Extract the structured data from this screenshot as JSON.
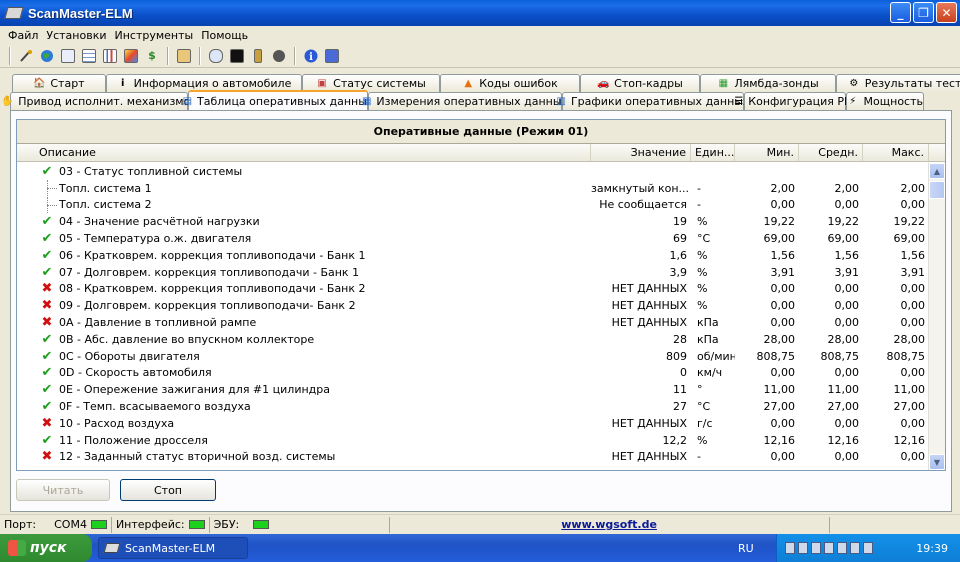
{
  "window": {
    "title": "ScanMaster-ELM"
  },
  "menu": [
    "Файл",
    "Установки",
    "Инструменты",
    "Помощь"
  ],
  "toolbar_icons": [
    "connect-icon",
    "globe-icon",
    "document-icon",
    "table-icon",
    "chart-icon",
    "graph-icon",
    "dollar-icon",
    "clipboard-icon",
    "comment-icon",
    "terminal-icon",
    "plug-icon",
    "record-icon",
    "info-icon",
    "book-icon"
  ],
  "tabs_row1": [
    {
      "label": "Старт",
      "icon": "start-icon"
    },
    {
      "label": "Информация о автомобиле",
      "icon": "info-icon"
    },
    {
      "label": "Статус системы",
      "icon": "status-icon"
    },
    {
      "label": "Коды ошибок",
      "icon": "warning-icon"
    },
    {
      "label": "Стоп-кадры",
      "icon": "freeze-icon"
    },
    {
      "label": "Лямбда-зонды",
      "icon": "lambda-icon"
    },
    {
      "label": "Результаты теста",
      "icon": "gear-icon"
    }
  ],
  "tabs_row2": [
    {
      "label": "Привод исполнит. механизмов",
      "icon": "actuator-icon",
      "active": false
    },
    {
      "label": "Таблица оперативных данных",
      "icon": "table-icon",
      "active": true
    },
    {
      "label": "Измерения оперативных данных",
      "icon": "meter-icon",
      "active": false
    },
    {
      "label": "Графики оперативных данных",
      "icon": "chart-icon",
      "active": false
    },
    {
      "label": "Конфигурация PID",
      "icon": "config-icon",
      "active": false
    },
    {
      "label": "Мощность",
      "icon": "power-icon",
      "active": false
    }
  ],
  "grid": {
    "title": "Оперативные данные (Режим 01)",
    "headers": {
      "desc": "Описание",
      "value": "Значение",
      "unit": "Един...",
      "min": "Мин.",
      "avg": "Средн.",
      "max": "Макс."
    },
    "rows": [
      {
        "status": "ok",
        "child": false,
        "desc": "03 - Статус топливной системы",
        "value": "",
        "unit": "",
        "min": "",
        "avg": "",
        "max": ""
      },
      {
        "status": "",
        "child": true,
        "desc": "Топл. система 1",
        "value": "замкнутый кон...",
        "unit": "-",
        "min": "2,00",
        "avg": "2,00",
        "max": "2,00"
      },
      {
        "status": "",
        "child": true,
        "desc": "Топл. система 2",
        "value": "Не сообщается",
        "unit": "-",
        "min": "0,00",
        "avg": "0,00",
        "max": "0,00"
      },
      {
        "status": "ok",
        "child": false,
        "desc": "04 - Значение расчётной нагрузки",
        "value": "19",
        "unit": "%",
        "min": "19,22",
        "avg": "19,22",
        "max": "19,22"
      },
      {
        "status": "ok",
        "child": false,
        "desc": "05 - Температура о.ж. двигателя",
        "value": "69",
        "unit": "°C",
        "min": "69,00",
        "avg": "69,00",
        "max": "69,00"
      },
      {
        "status": "ok",
        "child": false,
        "desc": "06 - Кратковрем. коррекция топливоподачи - Банк 1",
        "value": "1,6",
        "unit": "%",
        "min": "1,56",
        "avg": "1,56",
        "max": "1,56"
      },
      {
        "status": "ok",
        "child": false,
        "desc": "07 - Долговрем. коррекция топливоподачи - Банк 1",
        "value": "3,9",
        "unit": "%",
        "min": "3,91",
        "avg": "3,91",
        "max": "3,91"
      },
      {
        "status": "bad",
        "child": false,
        "desc": "08 - Кратковрем. коррекция топливоподачи - Банк 2",
        "value": "НЕТ ДАННЫХ",
        "unit": "%",
        "min": "0,00",
        "avg": "0,00",
        "max": "0,00"
      },
      {
        "status": "bad",
        "child": false,
        "desc": "09 - Долговрем. коррекция топливоподачи- Банк 2",
        "value": "НЕТ ДАННЫХ",
        "unit": "%",
        "min": "0,00",
        "avg": "0,00",
        "max": "0,00"
      },
      {
        "status": "bad",
        "child": false,
        "desc": "0A - Давление в топливной рампе",
        "value": "НЕТ ДАННЫХ",
        "unit": "кПа",
        "min": "0,00",
        "avg": "0,00",
        "max": "0,00"
      },
      {
        "status": "ok",
        "child": false,
        "desc": "0B - Абс. давление во впускном коллекторе",
        "value": "28",
        "unit": "кПа",
        "min": "28,00",
        "avg": "28,00",
        "max": "28,00"
      },
      {
        "status": "ok",
        "child": false,
        "desc": "0C - Обороты двигателя",
        "value": "809",
        "unit": "об/мин",
        "min": "808,75",
        "avg": "808,75",
        "max": "808,75"
      },
      {
        "status": "ok",
        "child": false,
        "desc": "0D - Скорость автомобиля",
        "value": "0",
        "unit": "км/ч",
        "min": "0,00",
        "avg": "0,00",
        "max": "0,00"
      },
      {
        "status": "ok",
        "child": false,
        "desc": "0E - Опережение зажигания для #1 цилиндра",
        "value": "11",
        "unit": "°",
        "min": "11,00",
        "avg": "11,00",
        "max": "11,00"
      },
      {
        "status": "ok",
        "child": false,
        "desc": "0F - Темп. всасываемого воздуха",
        "value": "27",
        "unit": "°C",
        "min": "27,00",
        "avg": "27,00",
        "max": "27,00"
      },
      {
        "status": "bad",
        "child": false,
        "desc": "10 - Расход воздуха",
        "value": "НЕТ ДАННЫХ",
        "unit": "г/с",
        "min": "0,00",
        "avg": "0,00",
        "max": "0,00"
      },
      {
        "status": "ok",
        "child": false,
        "desc": "11 - Положение дросселя",
        "value": "12,2",
        "unit": "%",
        "min": "12,16",
        "avg": "12,16",
        "max": "12,16"
      },
      {
        "status": "bad",
        "child": false,
        "desc": "12 - Заданный статус вторичной возд. системы",
        "value": "НЕТ ДАННЫХ",
        "unit": "-",
        "min": "0,00",
        "avg": "0,00",
        "max": "0,00"
      }
    ]
  },
  "buttons": {
    "read": "Читать",
    "stop": "Стоп"
  },
  "statusbar": {
    "port_label": "Порт:",
    "port_value": "COM4",
    "interface_label": "Интерфейс:",
    "ecu_label": "ЭБУ:",
    "url": "www.wgsoft.de"
  },
  "taskbar": {
    "start": "пуск",
    "task": "ScanMaster-ELM",
    "lang": "RU",
    "clock": "19:39"
  },
  "colors": {
    "ok": "#1c9e1c",
    "bad": "#d01010",
    "led": "#1ed01e",
    "titlebar": "#0a4fc8"
  }
}
